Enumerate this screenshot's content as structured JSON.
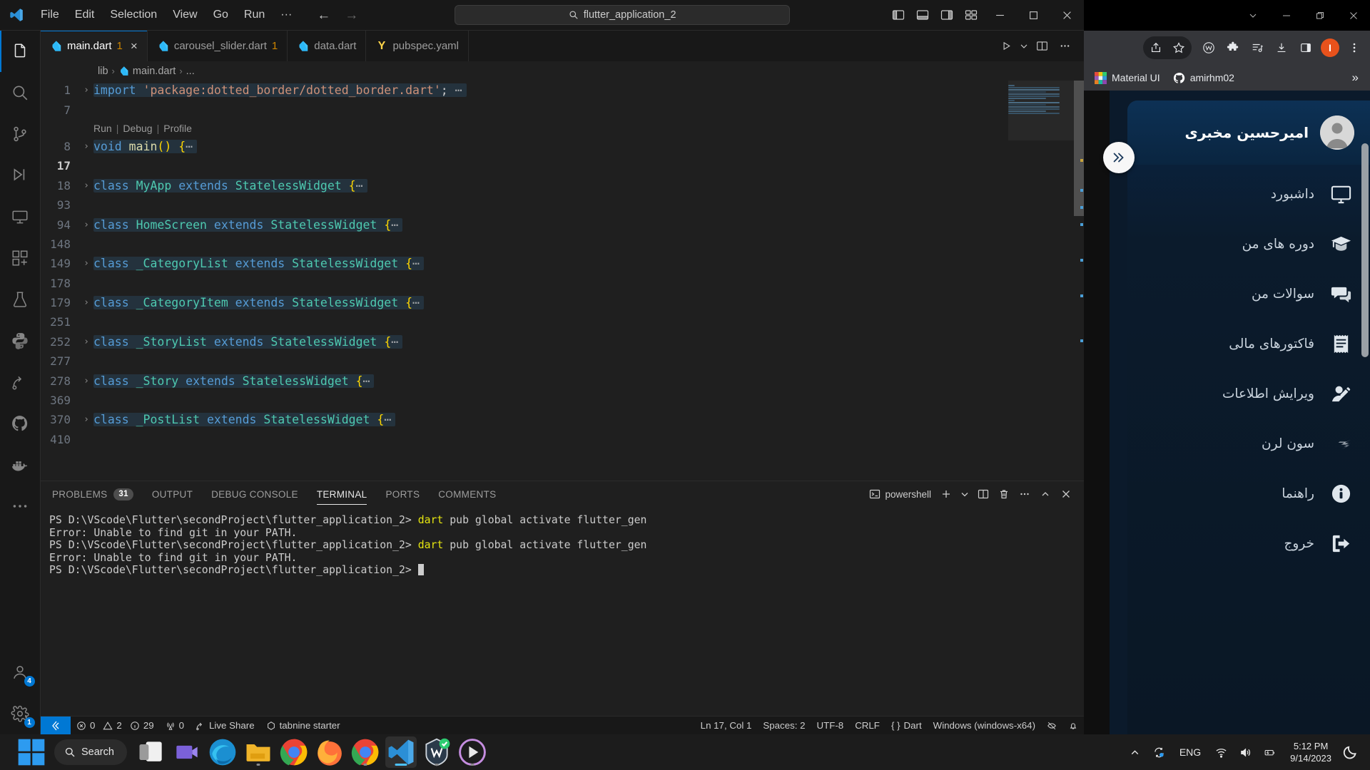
{
  "vscode": {
    "menus": [
      "File",
      "Edit",
      "Selection",
      "View",
      "Go",
      "Run",
      "···"
    ],
    "search_value": "flutter_application_2",
    "tabs": [
      {
        "label": "main.dart",
        "badge": "1",
        "icon": "dart-icon",
        "active": true,
        "close": "×"
      },
      {
        "label": "carousel_slider.dart",
        "badge": "1",
        "icon": "dart-icon",
        "active": false
      },
      {
        "label": "data.dart",
        "badge": "",
        "icon": "dart-icon",
        "active": false
      },
      {
        "label": "pubspec.yaml",
        "badge": "",
        "icon": "yaml-icon",
        "active": false
      }
    ],
    "breadcrumb": [
      "lib",
      "main.dart",
      "..."
    ],
    "codelens": {
      "run": "Run",
      "debug": "Debug",
      "profile": "Profile"
    },
    "code_lines": [
      {
        "num": "1",
        "fold": "›",
        "highlight": true,
        "tokens": [
          {
            "t": "import ",
            "c": "k-kw"
          },
          {
            "t": "'package:dotted_border/dotted_border.dart'",
            "c": "k-str"
          },
          {
            "t": ";",
            "c": "k-plain"
          },
          {
            "t": " ⋯",
            "c": "k-dots"
          }
        ]
      },
      {
        "num": "7",
        "fold": "",
        "highlight": false,
        "tokens": []
      },
      {
        "num": "8",
        "fold": "›",
        "highlight": true,
        "tokens": [
          {
            "t": "void ",
            "c": "k-kw"
          },
          {
            "t": "main",
            "c": "k-fn"
          },
          {
            "t": "(",
            "c": "k-punc"
          },
          {
            "t": ")",
            "c": "k-punc"
          },
          {
            "t": " ",
            "c": "k-plain"
          },
          {
            "t": "{",
            "c": "k-punc"
          },
          {
            "t": "⋯",
            "c": "k-dots"
          }
        ]
      },
      {
        "num": "17",
        "fold": "",
        "highlight": false,
        "current": true,
        "tokens": []
      },
      {
        "num": "18",
        "fold": "›",
        "highlight": true,
        "tokens": [
          {
            "t": "class ",
            "c": "k-kw"
          },
          {
            "t": "MyApp",
            "c": "k-type"
          },
          {
            "t": " extends ",
            "c": "k-kw"
          },
          {
            "t": "StatelessWidget",
            "c": "k-type"
          },
          {
            "t": " ",
            "c": "k-plain"
          },
          {
            "t": "{",
            "c": "k-punc"
          },
          {
            "t": "⋯",
            "c": "k-dots"
          }
        ]
      },
      {
        "num": "93",
        "fold": "",
        "highlight": false,
        "tokens": []
      },
      {
        "num": "94",
        "fold": "›",
        "highlight": true,
        "tokens": [
          {
            "t": "class ",
            "c": "k-kw"
          },
          {
            "t": "HomeScreen",
            "c": "k-type"
          },
          {
            "t": " extends ",
            "c": "k-kw"
          },
          {
            "t": "StatelessWidget",
            "c": "k-type"
          },
          {
            "t": " ",
            "c": "k-plain"
          },
          {
            "t": "{",
            "c": "k-punc"
          },
          {
            "t": "⋯",
            "c": "k-dots"
          }
        ]
      },
      {
        "num": "148",
        "fold": "",
        "highlight": false,
        "tokens": []
      },
      {
        "num": "149",
        "fold": "›",
        "highlight": true,
        "tokens": [
          {
            "t": "class ",
            "c": "k-kw"
          },
          {
            "t": "_CategoryList",
            "c": "k-type"
          },
          {
            "t": " extends ",
            "c": "k-kw"
          },
          {
            "t": "StatelessWidget",
            "c": "k-type"
          },
          {
            "t": " ",
            "c": "k-plain"
          },
          {
            "t": "{",
            "c": "k-punc"
          },
          {
            "t": "⋯",
            "c": "k-dots"
          }
        ]
      },
      {
        "num": "178",
        "fold": "",
        "highlight": false,
        "tokens": []
      },
      {
        "num": "179",
        "fold": "›",
        "highlight": true,
        "tokens": [
          {
            "t": "class ",
            "c": "k-kw"
          },
          {
            "t": "_CategoryItem",
            "c": "k-type"
          },
          {
            "t": " extends ",
            "c": "k-kw"
          },
          {
            "t": "StatelessWidget",
            "c": "k-type"
          },
          {
            "t": " ",
            "c": "k-plain"
          },
          {
            "t": "{",
            "c": "k-punc"
          },
          {
            "t": "⋯",
            "c": "k-dots"
          }
        ]
      },
      {
        "num": "251",
        "fold": "",
        "highlight": false,
        "tokens": []
      },
      {
        "num": "252",
        "fold": "›",
        "highlight": true,
        "tokens": [
          {
            "t": "class ",
            "c": "k-kw"
          },
          {
            "t": "_StoryList",
            "c": "k-type"
          },
          {
            "t": " extends ",
            "c": "k-kw"
          },
          {
            "t": "StatelessWidget",
            "c": "k-type"
          },
          {
            "t": " ",
            "c": "k-plain"
          },
          {
            "t": "{",
            "c": "k-punc"
          },
          {
            "t": "⋯",
            "c": "k-dots"
          }
        ]
      },
      {
        "num": "277",
        "fold": "",
        "highlight": false,
        "tokens": []
      },
      {
        "num": "278",
        "fold": "›",
        "highlight": true,
        "tokens": [
          {
            "t": "class ",
            "c": "k-kw"
          },
          {
            "t": "_Story",
            "c": "k-type"
          },
          {
            "t": " extends ",
            "c": "k-kw"
          },
          {
            "t": "StatelessWidget",
            "c": "k-type"
          },
          {
            "t": " ",
            "c": "k-plain"
          },
          {
            "t": "{",
            "c": "k-punc"
          },
          {
            "t": "⋯",
            "c": "k-dots"
          }
        ]
      },
      {
        "num": "369",
        "fold": "",
        "highlight": false,
        "tokens": []
      },
      {
        "num": "370",
        "fold": "›",
        "highlight": true,
        "tokens": [
          {
            "t": "class ",
            "c": "k-kw"
          },
          {
            "t": "_PostList",
            "c": "k-type"
          },
          {
            "t": " extends ",
            "c": "k-kw"
          },
          {
            "t": "StatelessWidget",
            "c": "k-type"
          },
          {
            "t": " ",
            "c": "k-plain"
          },
          {
            "t": "{",
            "c": "k-punc"
          },
          {
            "t": "⋯",
            "c": "k-dots"
          }
        ]
      },
      {
        "num": "410",
        "fold": "",
        "highlight": false,
        "tokens": []
      }
    ],
    "panel": {
      "tabs": [
        {
          "label": "PROBLEMS",
          "badge": "31",
          "active": false
        },
        {
          "label": "OUTPUT",
          "badge": "",
          "active": false
        },
        {
          "label": "DEBUG CONSOLE",
          "badge": "",
          "active": false
        },
        {
          "label": "TERMINAL",
          "badge": "",
          "active": true
        },
        {
          "label": "PORTS",
          "badge": "",
          "active": false
        },
        {
          "label": "COMMENTS",
          "badge": "",
          "active": false
        }
      ],
      "shell_label": "powershell",
      "terminal_lines": [
        {
          "prompt": "PS D:\\VScode\\Flutter\\secondProject\\flutter_application_2> ",
          "cmd": "dart",
          "rest": " pub global activate flutter_gen"
        },
        {
          "prompt": "",
          "cmd": "",
          "rest": "Error: Unable to find git in your PATH."
        },
        {
          "prompt": "PS D:\\VScode\\Flutter\\secondProject\\flutter_application_2> ",
          "cmd": "dart",
          "rest": " pub global activate flutter_gen"
        },
        {
          "prompt": "",
          "cmd": "",
          "rest": "Error: Unable to find git in your PATH."
        },
        {
          "prompt": "PS D:\\VScode\\Flutter\\secondProject\\flutter_application_2> ",
          "cmd": "",
          "rest": "",
          "caret": true
        }
      ]
    },
    "statusbar": {
      "errors": "0",
      "warnings": "2",
      "infos": "29",
      "radio_count": "0",
      "live_share": "Live Share",
      "tabnine": "tabnine starter",
      "cursor": "Ln 17, Col 1",
      "spaces": "Spaces: 2",
      "encoding": "UTF-8",
      "eol": "CRLF",
      "language": "Dart",
      "platform": "Windows (windows-x64)"
    }
  },
  "browser": {
    "bookmarks": [
      {
        "label": "Material UI",
        "icon": "material-ui-favicon"
      },
      {
        "label": "amirhm02",
        "icon": "github-favicon"
      }
    ],
    "overflow": "»",
    "avatar_initial": "I"
  },
  "dashboard": {
    "user_name": "امیرحسین مخبری",
    "menu": [
      {
        "label": "داشبورد",
        "icon": "monitor-icon"
      },
      {
        "label": "دوره های من",
        "icon": "graduation-cap-icon"
      },
      {
        "label": "سوالات من",
        "icon": "chat-bubbles-icon"
      },
      {
        "label": "فاکتورهای مالی",
        "icon": "receipt-icon"
      },
      {
        "label": "ویرایش اطلاعات",
        "icon": "edit-user-icon"
      },
      {
        "label": "سون لرن",
        "icon": "sevenlearn-logo-icon"
      },
      {
        "label": "راهنما",
        "icon": "info-icon"
      },
      {
        "label": "خروج",
        "icon": "logout-icon"
      }
    ]
  },
  "taskbar": {
    "search_label": "Search",
    "language": "ENG",
    "time": "5:12 PM",
    "date": "9/14/2023"
  },
  "colors": {
    "accent": "#0078d4",
    "modified_tab": "#cc8400",
    "error_red": "#c42b1c",
    "terminal_cmd": "#e5e510",
    "dashboard_blue": "#0a2545"
  }
}
